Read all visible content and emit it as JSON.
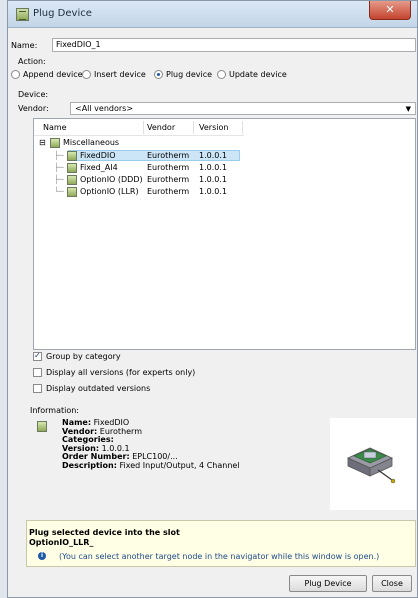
{
  "window": {
    "title": "Plug Device",
    "close_glyph": "✕"
  },
  "name_field": {
    "label": "Name:",
    "value": "FixedDIO_1"
  },
  "action": {
    "label": "Action:",
    "options": [
      {
        "label": "Append device",
        "selected": false
      },
      {
        "label": "Insert device",
        "selected": false
      },
      {
        "label": "Plug device",
        "selected": true
      },
      {
        "label": "Update device",
        "selected": false
      }
    ]
  },
  "device": {
    "label": "Device:"
  },
  "vendor": {
    "label": "Vendor:",
    "selected": "<All vendors>"
  },
  "tree": {
    "columns": [
      "Name",
      "Vendor",
      "Version"
    ],
    "group": {
      "label": "Miscellaneous",
      "expand_glyph": "⊟"
    },
    "rows": [
      {
        "name": "FixedDIO",
        "vendor": "Eurotherm",
        "version": "1.0.0.1",
        "selected": true
      },
      {
        "name": "Fixed_AI4",
        "vendor": "Eurotherm",
        "version": "1.0.0.1",
        "selected": false
      },
      {
        "name": "OptionIO (DDD)",
        "vendor": "Eurotherm",
        "version": "1.0.0.1",
        "selected": false
      },
      {
        "name": "OptionIO (LLR)",
        "vendor": "Eurotherm",
        "version": "1.0.0.1",
        "selected": false
      }
    ]
  },
  "options": [
    {
      "label": "Group by category",
      "checked": true
    },
    {
      "label": "Display all versions (for experts only)",
      "checked": false
    },
    {
      "label": "Display outdated versions",
      "checked": false
    }
  ],
  "information": {
    "title": "Information:",
    "lines": [
      {
        "key": "Name:",
        "value": " FixedDIO"
      },
      {
        "key": "Vendor:",
        "value": " Eurotherm"
      },
      {
        "key": "Categories:",
        "value": ""
      },
      {
        "key": "Version:",
        "value": " 1.0.0.1"
      },
      {
        "key": "Order Number:",
        "value": " EPLC100/..."
      },
      {
        "key": "Description:",
        "value": " Fixed Input/Output, 4 Channel"
      }
    ]
  },
  "hint": {
    "line1": "Plug selected device into the slot",
    "line2": "OptionIO_LLR_",
    "note": "(You can select another target node in the navigator while this window is open.)"
  },
  "buttons": {
    "plug": "Plug Device",
    "close": "Close"
  },
  "colors": {
    "accent": "#1e5aa8",
    "selection": "#cde6f7",
    "hint_bg": "#ffffe5"
  }
}
